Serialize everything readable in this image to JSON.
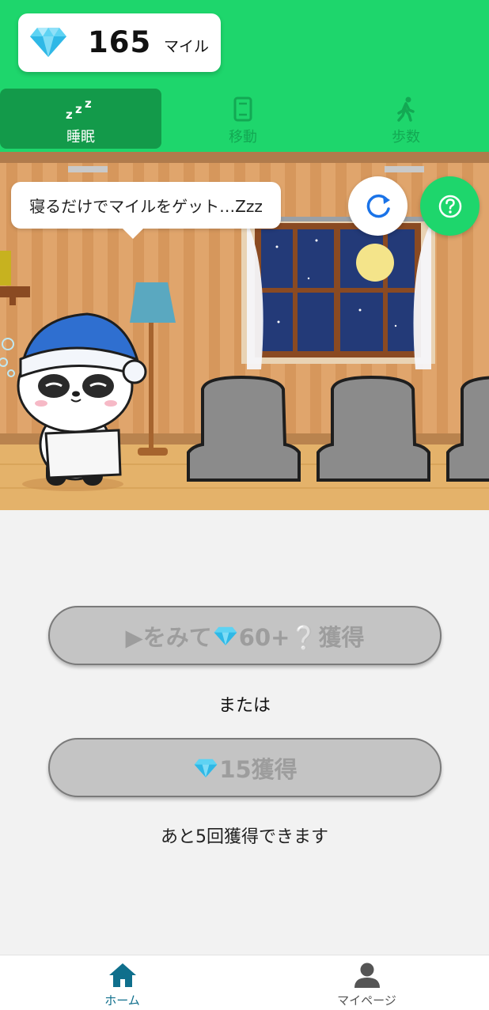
{
  "header": {
    "miles_value": "165",
    "miles_unit": "マイル",
    "gem_icon": "diamond-icon"
  },
  "tabs": [
    {
      "label": "睡眠",
      "icon": "zzz-icon",
      "active": true
    },
    {
      "label": "移動",
      "icon": "route-icon",
      "active": false
    },
    {
      "label": "歩数",
      "icon": "walking-icon",
      "active": false
    }
  ],
  "scene": {
    "speech_bubble": "寝るだけでマイルをゲット…Zzz",
    "refresh_icon": "refresh-icon",
    "help_icon": "question-icon"
  },
  "actions": {
    "video_button_prefix": "▶をみて",
    "video_button_suffix": "60+❔獲得",
    "or_text": "または",
    "claim_button_suffix": "15獲得",
    "remaining_text": "あと5回獲得できます"
  },
  "bottom_nav": [
    {
      "label": "ホーム",
      "icon": "home-icon",
      "active": true
    },
    {
      "label": "マイページ",
      "icon": "person-icon",
      "active": false
    }
  ],
  "colors": {
    "brand_green": "#1ed66c",
    "active_tab": "#139a4a",
    "disabled_button": "#c4c4c4",
    "nav_active": "#0f6f8c"
  }
}
